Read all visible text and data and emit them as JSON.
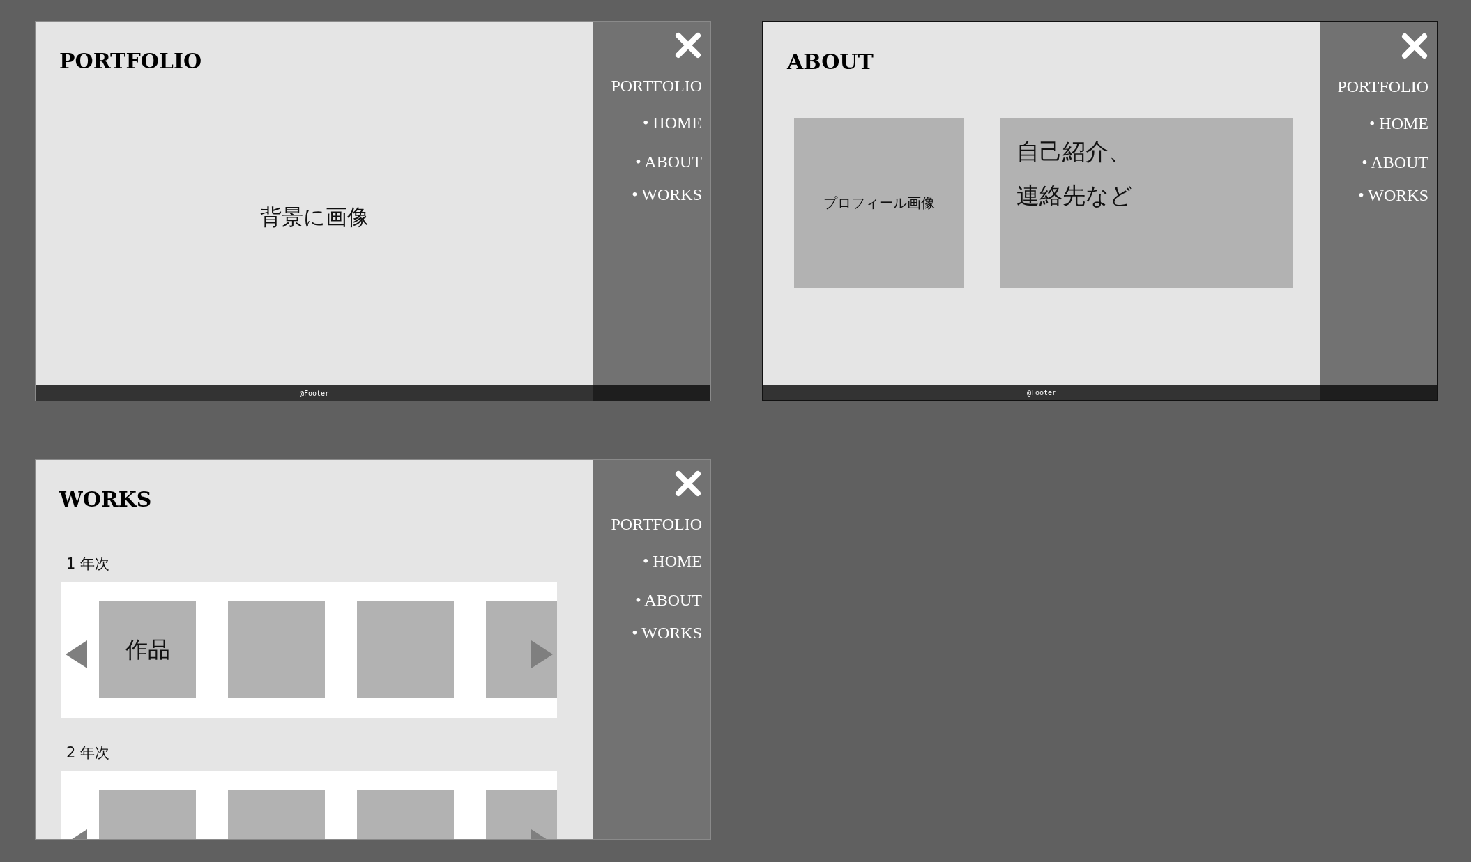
{
  "artboards": [
    {
      "kind": "home",
      "selected": false,
      "title": "PORTFOLIO",
      "background_label": "背景に画像",
      "menu": {
        "brand": "PORTFOLIO",
        "items": [
          "• HOME",
          "• ABOUT",
          "• WORKS"
        ]
      },
      "footer": "@Footer"
    },
    {
      "kind": "about",
      "selected": true,
      "title": "ABOUT",
      "profile_label": "プロフィール画像",
      "intro_lines": [
        "自己紹介、",
        "連絡先など"
      ],
      "menu": {
        "brand": "PORTFOLIO",
        "items": [
          "• HOME",
          "• ABOUT",
          "• WORKS"
        ]
      },
      "footer": "@Footer"
    },
    {
      "kind": "works",
      "selected": false,
      "title": "WORKS",
      "menu": {
        "brand": "PORTFOLIO",
        "items": [
          "• HOME",
          "• ABOUT",
          "• WORKS"
        ]
      },
      "years": [
        {
          "label": "1 年次",
          "works": [
            {
              "kind": "labeled",
              "label": "作品"
            },
            {
              "kind": "blank"
            },
            {
              "kind": "blank"
            },
            {
              "kind": "blank"
            }
          ]
        },
        {
          "label": "2 年次",
          "works": [
            {
              "kind": "blank"
            },
            {
              "kind": "blank"
            },
            {
              "kind": "blank"
            },
            {
              "kind": "blank"
            }
          ]
        }
      ]
    }
  ]
}
